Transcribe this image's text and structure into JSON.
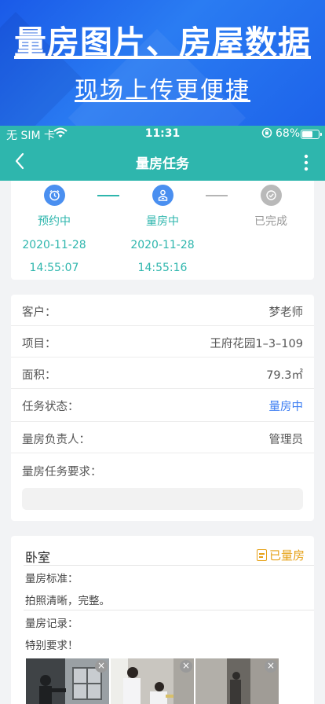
{
  "banner": {
    "headline": "量房图片、房屋数据",
    "subline": "现场上传更便捷"
  },
  "status_bar": {
    "carrier": "无 SIM 卡",
    "time": "11:31",
    "battery_text": "68%",
    "battery_level": 0.68
  },
  "nav": {
    "title": "量房任务",
    "back_icon": "chevron-left-icon",
    "more_icon": "more-vertical-icon"
  },
  "progress": {
    "steps": [
      {
        "label": "预约中",
        "date": "2020-11-28",
        "time": "14:55:07",
        "icon": "alarm-clock-icon",
        "color": "#2eb6ad"
      },
      {
        "label": "量房中",
        "date": "2020-11-28",
        "time": "14:55:16",
        "icon": "worker-icon",
        "color": "#2eb6ad"
      },
      {
        "label": "已完成",
        "date": "",
        "time": "",
        "icon": "check-circle-icon",
        "color": "#999999"
      }
    ]
  },
  "info": {
    "rows": [
      {
        "key": "客户：",
        "value": "梦老师"
      },
      {
        "key": "项目：",
        "value": "王府花园1–3–109"
      },
      {
        "key": "面积：",
        "value": "79.3㎡"
      },
      {
        "key": "任务状态：",
        "value": "量房中"
      },
      {
        "key": "量房负责人：",
        "value": "管理员"
      }
    ],
    "requirement_label": "量房任务要求：",
    "requirement_value": ""
  },
  "room": {
    "name": "卧室",
    "status": "已量房",
    "standard_label": "量房标准：",
    "standard_text": "拍照清晰，完整。",
    "record_label": "量房记录：",
    "record_text": "特别要求！",
    "photos": [
      "room-photo-1",
      "room-photo-2",
      "room-photo-3"
    ],
    "remove_glyph": "×"
  },
  "colors": {
    "teal": "#2eb6ad",
    "blue": "#3d7ef2",
    "orange": "#e6a117",
    "banner_blue": "#1d63ea"
  }
}
